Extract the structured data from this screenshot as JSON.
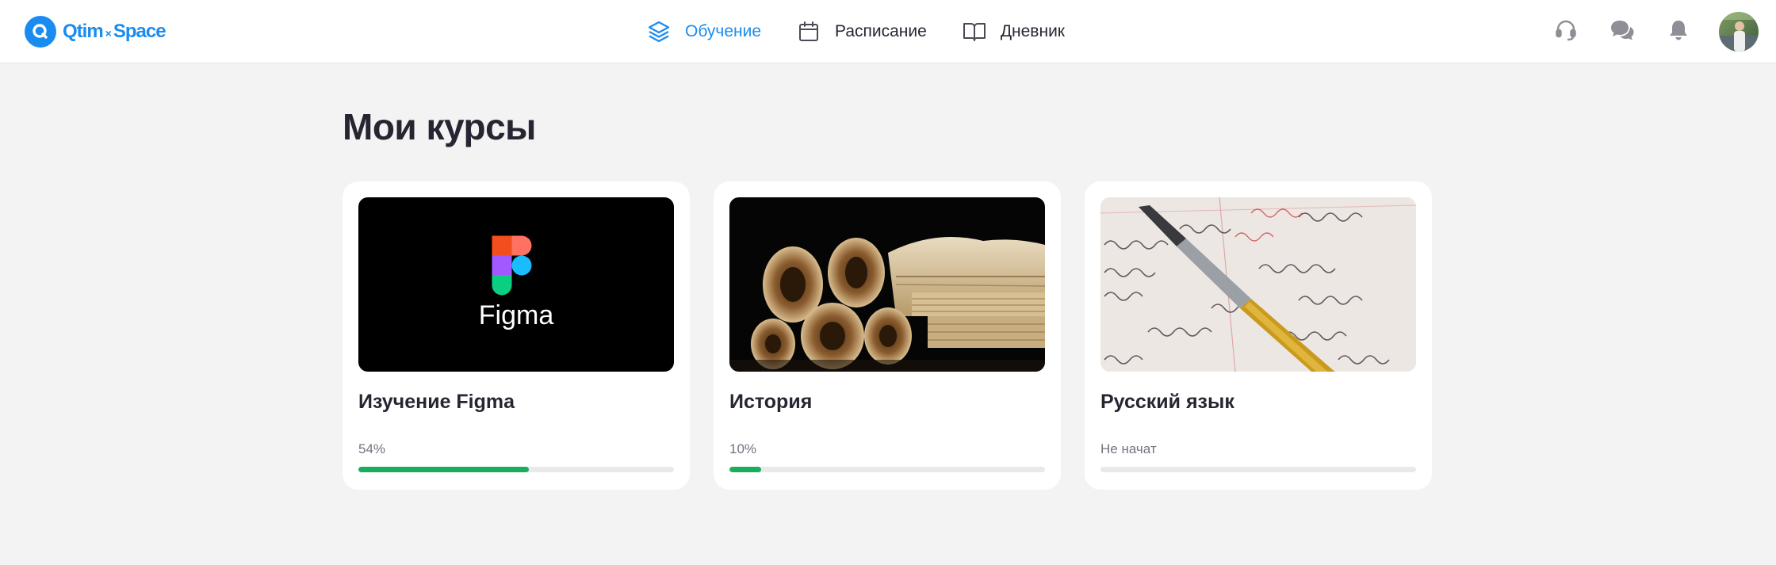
{
  "brand": {
    "name_left": "Qtim",
    "separator": "×",
    "name_right": "Space"
  },
  "nav": {
    "items": [
      {
        "label": "Обучение",
        "icon": "layers-icon",
        "active": true
      },
      {
        "label": "Расписание",
        "icon": "calendar-icon",
        "active": false
      },
      {
        "label": "Дневник",
        "icon": "book-icon",
        "active": false
      }
    ]
  },
  "header_actions": [
    "headset-icon",
    "chat-icon",
    "bell-icon",
    "avatar"
  ],
  "main": {
    "title": "Мои курсы",
    "courses": [
      {
        "title": "Изучение Figma",
        "status": "54%",
        "progress": 0.54,
        "cover": "figma-logo",
        "cover_text": "Figma"
      },
      {
        "title": "История",
        "status": "10%",
        "progress": 0.1,
        "cover": "old-books-scrolls"
      },
      {
        "title": "Русский язык",
        "status": "Не начат",
        "progress": 0,
        "cover": "fountain-pen-handwriting"
      }
    ]
  },
  "colors": {
    "accent": "#1a8cf0",
    "progress": "#19ae5c",
    "background": "#f3f3f3",
    "text": "#262633"
  }
}
